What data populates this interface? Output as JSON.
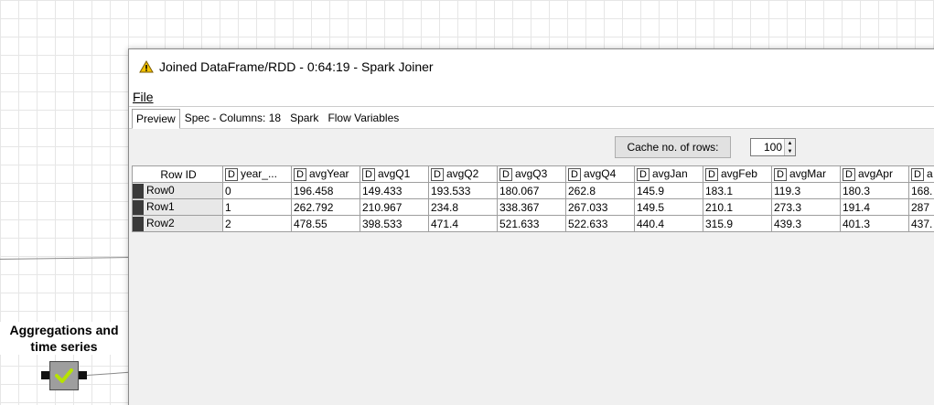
{
  "workflow": {
    "node_label": "Aggregations and time series"
  },
  "window": {
    "title": "Joined DataFrame/RDD - 0:64:19 - Spark Joiner",
    "menu": {
      "file": "File"
    },
    "tabs": [
      {
        "label": "Preview",
        "active": true
      },
      {
        "label": "Spec - Columns: 18",
        "active": false
      },
      {
        "label": "Spark",
        "active": false
      },
      {
        "label": "Flow Variables",
        "active": false
      }
    ],
    "cache_button": "Cache no. of rows:",
    "cache_value": "100",
    "table": {
      "rowid_header": "Row ID",
      "type_badge": "D",
      "columns": [
        "year_...",
        "avgYear",
        "avgQ1",
        "avgQ2",
        "avgQ3",
        "avgQ4",
        "avgJan",
        "avgFeb",
        "avgMar",
        "avgApr",
        "a"
      ],
      "rows": [
        {
          "id": "Row0",
          "cells": [
            "0",
            "196.458",
            "149.433",
            "193.533",
            "180.067",
            "262.8",
            "145.9",
            "183.1",
            "119.3",
            "180.3",
            "168."
          ]
        },
        {
          "id": "Row1",
          "cells": [
            "1",
            "262.792",
            "210.967",
            "234.8",
            "338.367",
            "267.033",
            "149.5",
            "210.1",
            "273.3",
            "191.4",
            "287"
          ]
        },
        {
          "id": "Row2",
          "cells": [
            "2",
            "478.55",
            "398.533",
            "471.4",
            "521.633",
            "522.633",
            "440.4",
            "315.9",
            "439.3",
            "401.3",
            "437."
          ]
        }
      ]
    }
  },
  "colors": {
    "warning": "#f2c200",
    "check": "#b7e300",
    "node": "#9e9e9e"
  }
}
